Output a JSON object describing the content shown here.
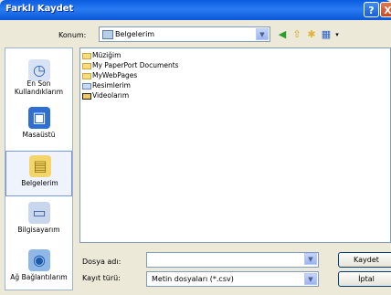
{
  "window": {
    "title": "Farklı Kaydet"
  },
  "location": {
    "label": "Konum:",
    "value": "Belgelerim"
  },
  "sidebar": {
    "items": [
      {
        "label": "En Son Kullandıklarım",
        "icon": "recent-icon"
      },
      {
        "label": "Masaüstü",
        "icon": "desktop-icon"
      },
      {
        "label": "Belgelerim",
        "icon": "my-documents-icon",
        "selected": true
      },
      {
        "label": "Bilgisayarım",
        "icon": "my-computer-icon"
      },
      {
        "label": "Ağ Bağlantılarım",
        "icon": "network-icon"
      }
    ]
  },
  "files": [
    {
      "name": "Müziğim",
      "icon": "music-folder-icon"
    },
    {
      "name": "My PaperPort Documents",
      "icon": "folder-icon"
    },
    {
      "name": "MyWebPages",
      "icon": "folder-icon"
    },
    {
      "name": "Resimlerim",
      "icon": "pictures-folder-icon"
    },
    {
      "name": "Videolarım",
      "icon": "video-folder-icon"
    }
  ],
  "form": {
    "filename_label": "Dosya adı:",
    "filename_value": "",
    "filetype_label": "Kayıt türü:",
    "filetype_value": "Metin dosyaları (*.csv)"
  },
  "buttons": {
    "save": "Kaydet",
    "cancel": "İptal"
  },
  "titlebar": {
    "help": "?",
    "close": "X"
  }
}
